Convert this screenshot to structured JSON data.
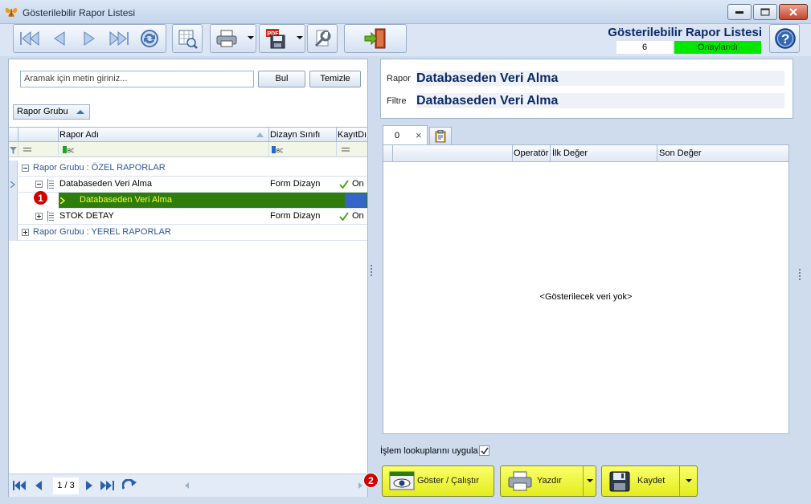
{
  "window": {
    "title": "Gösterilebilir Rapor Listesi"
  },
  "header": {
    "title": "Gösterilebilir Rapor Listesi",
    "count": "6",
    "status": "Onaylandı",
    "status_color": "#00e800"
  },
  "toolbar": {
    "icons": [
      "first-record-icon",
      "previous-record-icon",
      "next-record-icon",
      "last-record-icon",
      "refresh-icon",
      "preview-icon",
      "print-icon",
      "pdf-save-icon",
      "settings-icon",
      "exit-icon",
      "help-icon"
    ]
  },
  "search": {
    "placeholder": "Aramak için metin giriniz...",
    "find_label": "Bul",
    "clear_label": "Temizle"
  },
  "group_panel": {
    "label": "Rapor Grubu"
  },
  "grid": {
    "columns": [
      "Rapor Adı",
      "Dizayn Sınıfı",
      "KayıtDı"
    ],
    "groups": [
      {
        "label": "Rapor Grubu : ÖZEL RAPORLAR",
        "rows": [
          {
            "name": "Databaseden Veri Alma",
            "design": "Form Dizayn",
            "saved": "On"
          },
          {
            "name": "Databaseden Veri Alma",
            "design": "",
            "saved": ""
          },
          {
            "name": "STOK DETAY",
            "design": "Form Dizayn",
            "saved": "On"
          }
        ]
      },
      {
        "label": "Rapor Grubu : YEREL RAPORLAR",
        "rows": []
      }
    ]
  },
  "navigator": {
    "page": "1 / 3"
  },
  "markers": {
    "first": "1",
    "second": "2"
  },
  "info": {
    "report_label": "Rapor",
    "report_value": "Databaseden Veri Alma",
    "filter_label": "Filtre",
    "filter_value": "Databaseden Veri Alma"
  },
  "tabs": {
    "first_label": "0",
    "close_glyph": "×"
  },
  "params": {
    "columns": [
      "Operatör",
      "İlk Değer",
      "Son Değer"
    ],
    "empty_text": "<Gösterilecek veri yok>"
  },
  "options": {
    "lookup_label": "İşlem lookuplarını uygula",
    "lookup_checked": true
  },
  "actions": {
    "show_label": "Göster / Çalıştır",
    "print_label": "Yazdır",
    "save_label": "Kaydet",
    "button_color": "#eef43a"
  }
}
